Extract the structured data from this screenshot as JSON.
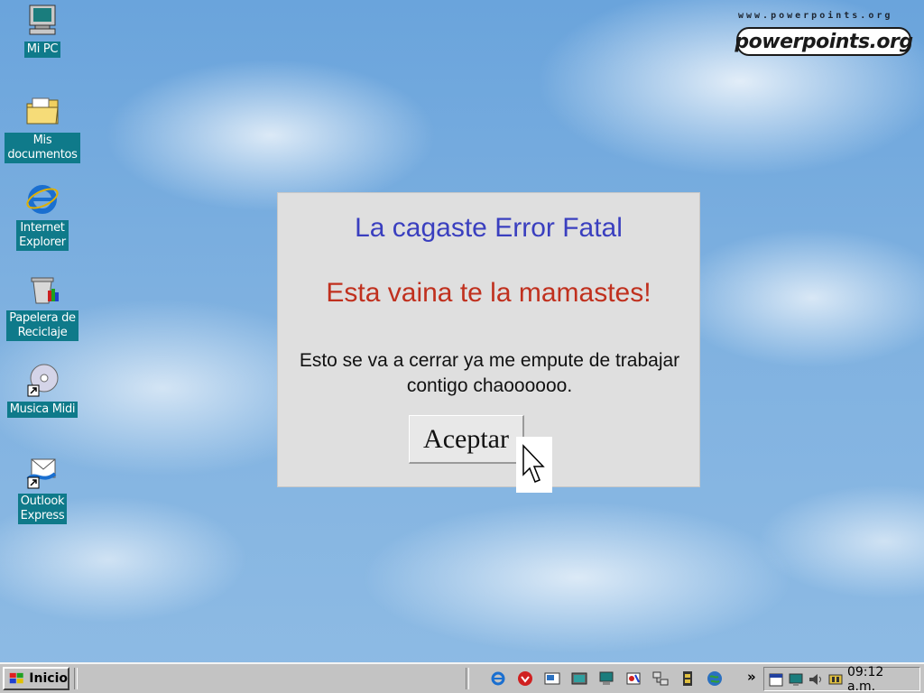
{
  "desktop": {
    "icons": [
      {
        "label": "Mi PC",
        "icon": "my-computer-icon"
      },
      {
        "label": "Mis\ndocumentos",
        "icon": "my-documents-icon"
      },
      {
        "label": "Internet\nExplorer",
        "icon": "internet-explorer-icon"
      },
      {
        "label": "Papelera de\nReciclaje",
        "icon": "recycle-bin-icon"
      },
      {
        "label": "Musica Midi",
        "icon": "music-cd-icon"
      },
      {
        "label": "Outlook\nExpress",
        "icon": "outlook-express-icon"
      }
    ]
  },
  "branding": {
    "url": "www.powerpoints.org",
    "logo": "powerpoints.org"
  },
  "dialog": {
    "title": "La cagaste Error Fatal",
    "subtitle": "Esta vaina te la mamastes!",
    "message": "Esto se va a cerrar ya me empute de trabajar contigo chaoooooo.",
    "button_label": "Aceptar"
  },
  "taskbar": {
    "start_label": "Inicio",
    "quicklaunch_icons": [
      "ie-icon",
      "outlook-icon",
      "desktop-icon",
      "channel-icon",
      "monitor-icon",
      "paint-icon",
      "network-icon",
      "film-icon",
      "globe-icon"
    ],
    "chevron": "»",
    "tray_icons": [
      "calendar-icon",
      "monitor-icon",
      "volume-icon",
      "sound-icon"
    ],
    "clock": "09:12 a.m."
  },
  "colors": {
    "title": "#3a3fbf",
    "subtitle": "#c0301e",
    "dialog_bg": "#dfdfdf",
    "icon_label_bg": "#0f7a8a",
    "taskbar_bg": "#c3c3c3"
  }
}
